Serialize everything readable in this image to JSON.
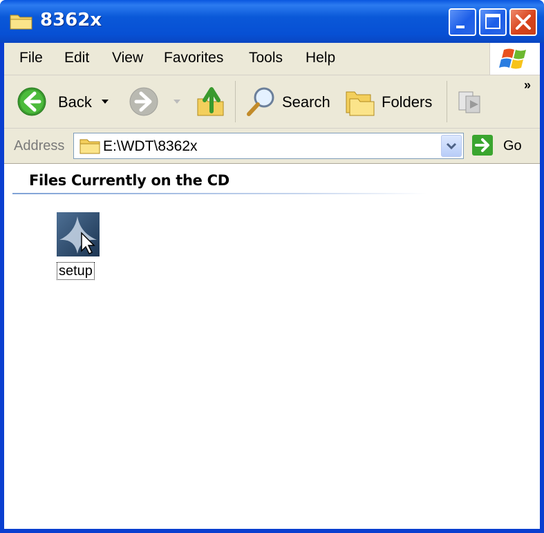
{
  "window": {
    "title": "8362x",
    "controls": [
      "minimize",
      "maximize",
      "close"
    ]
  },
  "menubar": {
    "items": [
      "File",
      "Edit",
      "View",
      "Favorites",
      "Tools",
      "Help"
    ]
  },
  "toolbar": {
    "back_label": "Back",
    "search_label": "Search",
    "folders_label": "Folders",
    "overflow": "»"
  },
  "address": {
    "label": "Address",
    "value": "E:\\WDT\\8362x",
    "go_label": "Go"
  },
  "content": {
    "group_header": "Files Currently on the CD",
    "files": [
      {
        "name": "setup",
        "icon": "setup-icon"
      }
    ]
  },
  "colors": {
    "titlebar": "#0a58d8",
    "frame": "#ece9d8",
    "close_button": "#d8431b",
    "back_arrow": "#3a9a2e"
  }
}
